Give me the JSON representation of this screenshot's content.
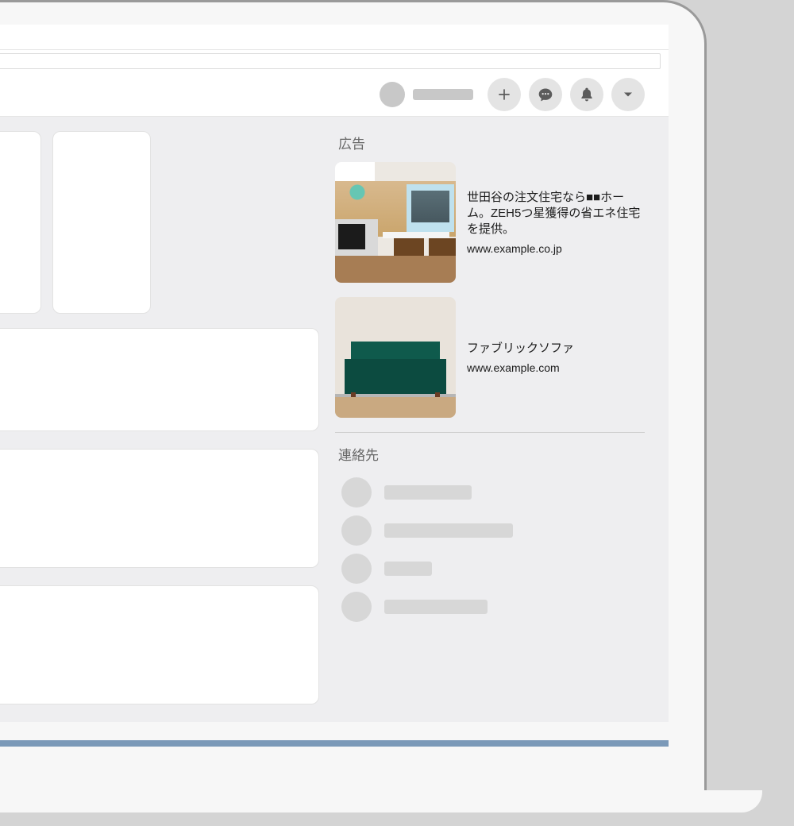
{
  "right_rail": {
    "ads_heading": "広告",
    "ads": [
      {
        "title": "世田谷の注文住宅なら■■ホーム。ZEH5つ星獲得の省エネ住宅を提供。",
        "url": "www.example.co.jp",
        "thumb": "kitchen"
      },
      {
        "title": "ファブリックソファ",
        "url": "www.example.com",
        "thumb": "sofa"
      }
    ],
    "contacts_heading": "連絡先",
    "contact_name_widths": [
      110,
      162,
      60,
      130
    ]
  },
  "topnav_icons": [
    "plus",
    "messages",
    "bell",
    "caret-down"
  ]
}
